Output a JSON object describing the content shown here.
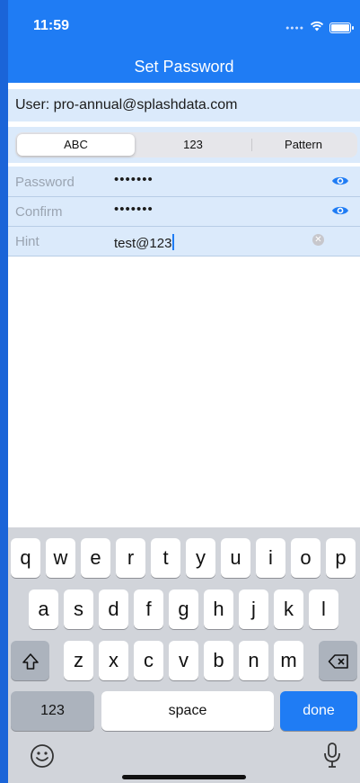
{
  "status_bar": {
    "time": "11:59"
  },
  "nav": {
    "title": "Set Password"
  },
  "user": {
    "label": "User: pro-annual@splashdata.com"
  },
  "segments": [
    {
      "label": "ABC",
      "selected": true
    },
    {
      "label": "123",
      "selected": false
    },
    {
      "label": "Pattern",
      "selected": false
    }
  ],
  "fields": {
    "password": {
      "label": "Password",
      "value": "•••••••"
    },
    "confirm": {
      "label": "Confirm",
      "value": "•••••••"
    },
    "hint": {
      "label": "Hint",
      "value": "test@123"
    }
  },
  "keyboard": {
    "row1": [
      "q",
      "w",
      "e",
      "r",
      "t",
      "y",
      "u",
      "i",
      "o",
      "p"
    ],
    "row2": [
      "a",
      "s",
      "d",
      "f",
      "g",
      "h",
      "j",
      "k",
      "l"
    ],
    "row3": [
      "z",
      "x",
      "c",
      "v",
      "b",
      "n",
      "m"
    ],
    "numbers_label": "123",
    "space_label": "space",
    "done_label": "done"
  },
  "colors": {
    "accent": "#1f7cf4",
    "field_bg": "#dbeafb",
    "keyboard_bg": "#d1d4da"
  }
}
